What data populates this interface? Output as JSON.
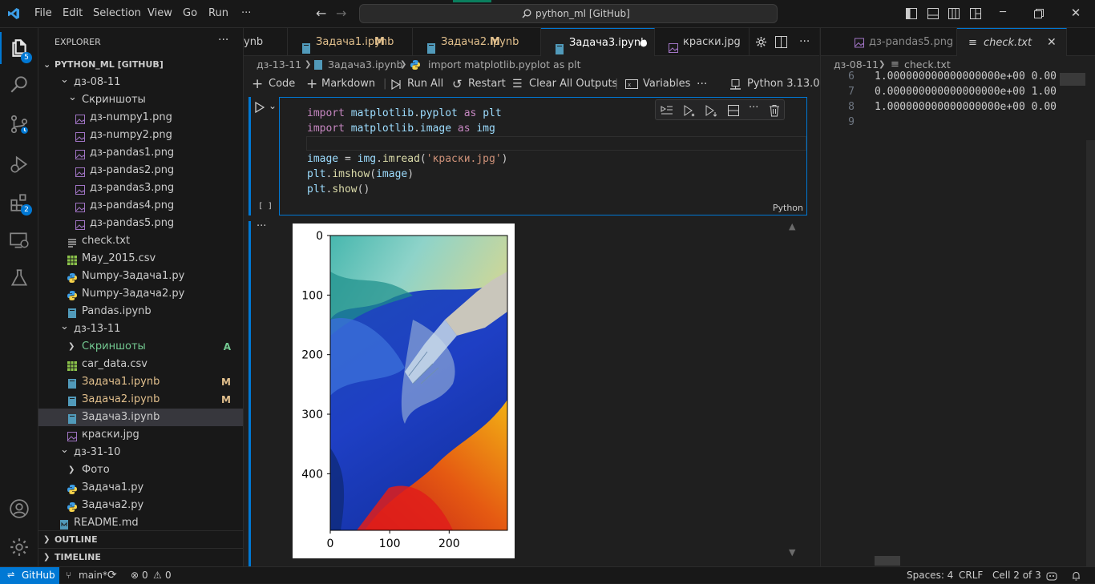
{
  "titlebar": {
    "menu": [
      "File",
      "Edit",
      "Selection",
      "View",
      "Go",
      "Run",
      "···"
    ],
    "search_text": "python_ml [GitHub]"
  },
  "activity": {
    "explorer_badge": "5",
    "extensions_badge": "2"
  },
  "sidebar": {
    "header": "EXPLORER",
    "more": "···",
    "root": "PYTHON_ML [GITHUB]",
    "items": [
      {
        "label": "дз-08-11",
        "type": "folder-open",
        "depth": 1
      },
      {
        "label": "Скриншоты",
        "type": "folder-open",
        "depth": 2
      },
      {
        "label": "дз-numpy1.png",
        "type": "image",
        "depth": 3
      },
      {
        "label": "дз-numpy2.png",
        "type": "image",
        "depth": 3
      },
      {
        "label": "дз-pandas1.png",
        "type": "image",
        "depth": 3
      },
      {
        "label": "дз-pandas2.png",
        "type": "image",
        "depth": 3
      },
      {
        "label": "дз-pandas3.png",
        "type": "image",
        "depth": 3
      },
      {
        "label": "дз-pandas4.png",
        "type": "image",
        "depth": 3
      },
      {
        "label": "дз-pandas5.png",
        "type": "image",
        "depth": 3
      },
      {
        "label": "check.txt",
        "type": "text",
        "depth": 2
      },
      {
        "label": "May_2015.csv",
        "type": "csv",
        "depth": 2
      },
      {
        "label": "Numpy-Задача1.py",
        "type": "python",
        "depth": 2
      },
      {
        "label": "Numpy-Задача2.py",
        "type": "python",
        "depth": 2
      },
      {
        "label": "Pandas.ipynb",
        "type": "notebook",
        "depth": 2
      },
      {
        "label": "дз-13-11",
        "type": "folder-open",
        "depth": 1
      },
      {
        "label": "Скриншоты",
        "type": "folder-closed",
        "depth": 2,
        "status": "A",
        "color": "#73c991"
      },
      {
        "label": "car_data.csv",
        "type": "csv",
        "depth": 2
      },
      {
        "label": "Задача1.ipynb",
        "type": "notebook",
        "depth": 2,
        "status": "M",
        "color": "#e2c08d"
      },
      {
        "label": "Задача2.ipynb",
        "type": "notebook",
        "depth": 2,
        "status": "M",
        "color": "#e2c08d"
      },
      {
        "label": "Задача3.ipynb",
        "type": "notebook",
        "depth": 2,
        "selected": true
      },
      {
        "label": "краски.jpg",
        "type": "image",
        "depth": 2
      },
      {
        "label": "дз-31-10",
        "type": "folder-open",
        "depth": 1
      },
      {
        "label": "Фото",
        "type": "folder-closed",
        "depth": 2
      },
      {
        "label": "Задача1.py",
        "type": "python",
        "depth": 2
      },
      {
        "label": "Задача2.py",
        "type": "python",
        "depth": 2
      },
      {
        "label": "README.md",
        "type": "markdown",
        "depth": 1
      }
    ],
    "outline": "OUTLINE",
    "timeline": "TIMELINE"
  },
  "editor": {
    "tabs": [
      {
        "label": "ynb",
        "type": "notebook"
      },
      {
        "label": "Задача1.ipynb",
        "status": "M",
        "type": "notebook"
      },
      {
        "label": "Задача2.ipynb",
        "status": "M",
        "type": "notebook"
      },
      {
        "label": "Задача3.ipynb",
        "type": "notebook",
        "active": true,
        "dirty": "●"
      },
      {
        "label": "краски.jpg",
        "type": "image"
      }
    ],
    "breadcrumb": [
      "дз-13-11",
      "Задача3.ipynb",
      "import matplotlib.pyplot as plt"
    ],
    "toolbar": {
      "code": "Code",
      "markdown": "Markdown",
      "run_all": "Run All",
      "restart": "Restart",
      "clear": "Clear All Outputs",
      "variables": "Variables",
      "more": "···",
      "kernel": "Python 3.13.0"
    },
    "cell": {
      "exec_count": "[ ]",
      "language": "Python",
      "lines": [
        [
          [
            "kw",
            "import"
          ],
          [
            "pl",
            " "
          ],
          [
            "id",
            "matplotlib"
          ],
          [
            "pl",
            "."
          ],
          [
            "id",
            "pyplot"
          ],
          [
            "pl",
            " "
          ],
          [
            "kw",
            "as"
          ],
          [
            "pl",
            " "
          ],
          [
            "id",
            "plt"
          ]
        ],
        [
          [
            "kw",
            "import"
          ],
          [
            "pl",
            " "
          ],
          [
            "id",
            "matplotlib"
          ],
          [
            "pl",
            "."
          ],
          [
            "id",
            "image"
          ],
          [
            "pl",
            " "
          ],
          [
            "kw",
            "as"
          ],
          [
            "pl",
            " "
          ],
          [
            "id",
            "img"
          ]
        ],
        [],
        [
          [
            "id",
            "image"
          ],
          [
            "pl",
            " = "
          ],
          [
            "id",
            "img"
          ],
          [
            "pl",
            "."
          ],
          [
            "fn",
            "imread"
          ],
          [
            "pl",
            "("
          ],
          [
            "str",
            "'краски.jpg'"
          ],
          [
            "pl",
            ")"
          ]
        ],
        [
          [
            "id",
            "plt"
          ],
          [
            "pl",
            "."
          ],
          [
            "fn",
            "imshow"
          ],
          [
            "pl",
            "("
          ],
          [
            "id",
            "image"
          ],
          [
            "pl",
            ")"
          ]
        ],
        [
          [
            "id",
            "plt"
          ],
          [
            "pl",
            "."
          ],
          [
            "fn",
            "show"
          ],
          [
            "pl",
            "()"
          ]
        ]
      ]
    },
    "output": {
      "more": "···",
      "y_ticks": [
        "0",
        "100",
        "200",
        "300",
        "400"
      ],
      "x_ticks": [
        "0",
        "100",
        "200"
      ]
    }
  },
  "right_editor": {
    "tabs": [
      {
        "label": "дз-pandas5.png",
        "type": "image"
      },
      {
        "label": "check.txt",
        "type": "text",
        "active": true
      }
    ],
    "breadcrumb": [
      "дз-08-11",
      "check.txt"
    ],
    "lines": [
      {
        "num": "6",
        "text": "1.000000000000000000e+00 0.00"
      },
      {
        "num": "7",
        "text": "0.000000000000000000e+00 1.00"
      },
      {
        "num": "8",
        "text": "1.000000000000000000e+00 0.00"
      },
      {
        "num": "9",
        "text": ""
      }
    ]
  },
  "statusbar": {
    "remote": "GitHub",
    "branch": "main*",
    "problems": "0",
    "warnings": "0",
    "spaces": "Spaces: 4",
    "eol": "CRLF",
    "cell": "Cell 2 of 3"
  },
  "colors": {
    "accent": "#0078d4",
    "modified": "#e2c08d",
    "added": "#73c991",
    "keyword": "#c586c0",
    "identifier": "#9cdcfe",
    "function": "#dcdcaa",
    "string": "#ce9178"
  }
}
